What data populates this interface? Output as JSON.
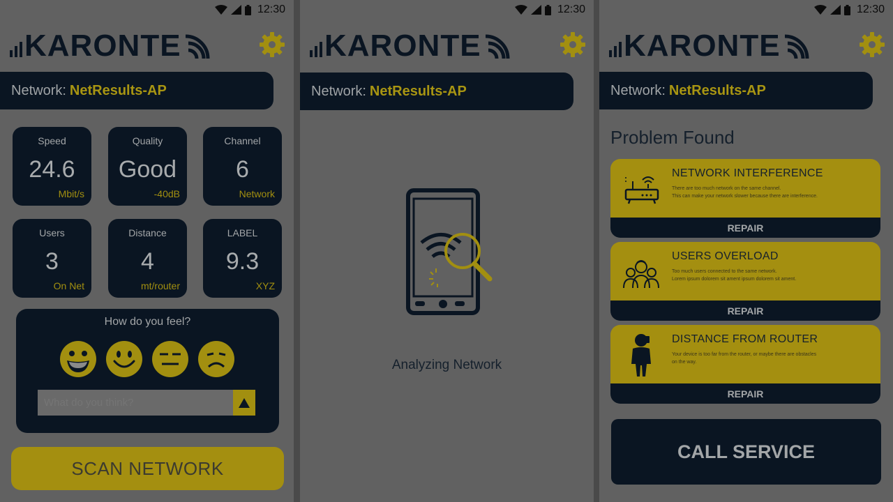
{
  "status_bar": {
    "time": "12:30"
  },
  "brand": {
    "logo_text": "KARONTE"
  },
  "network": {
    "label": "Network:",
    "name": "NetResults-AP"
  },
  "metrics": [
    {
      "label": "Speed",
      "value": "24.6",
      "unit": "Mbit/s"
    },
    {
      "label": "Quality",
      "value": "Good",
      "unit": "-40dB"
    },
    {
      "label": "Channel",
      "value": "6",
      "unit": "Network"
    },
    {
      "label": "Users",
      "value": "3",
      "unit": "On Net"
    },
    {
      "label": "Distance",
      "value": "4",
      "unit": "mt/router"
    },
    {
      "label": "LABEL",
      "value": "9.3",
      "unit": "XYZ"
    }
  ],
  "feedback": {
    "title": "How do you feel?",
    "faces": [
      "very-happy-face-icon",
      "happy-face-icon",
      "neutral-face-icon",
      "sad-face-icon"
    ],
    "input_placeholder": "What do you think?",
    "send_icon": "triangle-up-icon"
  },
  "scan_button": "SCAN NETWORK",
  "analyzing": {
    "text": "Analyzing Network",
    "icon": "phone-wifi-search-icon"
  },
  "problems": {
    "title": "Problem Found",
    "items": [
      {
        "title": "NETWORK INTERFERENCE",
        "desc_line1": "There are too much network on the same channel.",
        "desc_line2": "This can make your network slower because there are interference.",
        "icon": "router-icon",
        "action": "REPAIR"
      },
      {
        "title": "USERS OVERLOAD",
        "desc_line1": "Too much users connected to the same network.",
        "desc_line2": "Lorem ipsum dolorem sit ament  ipsum dolorem sit ament.",
        "icon": "users-group-icon",
        "action": "REPAIR"
      },
      {
        "title": "DISTANCE FROM ROUTER",
        "desc_line1": "Your device is too far from the router, or maybe there are obstacles",
        "desc_line2": "on the way.",
        "icon": "person-phone-icon",
        "action": "REPAIR"
      }
    ]
  },
  "call_button": "CALL SERVICE",
  "colors": {
    "navy": "#0a1522",
    "gold": "#a48f10",
    "overlay_gray": "#616161"
  }
}
